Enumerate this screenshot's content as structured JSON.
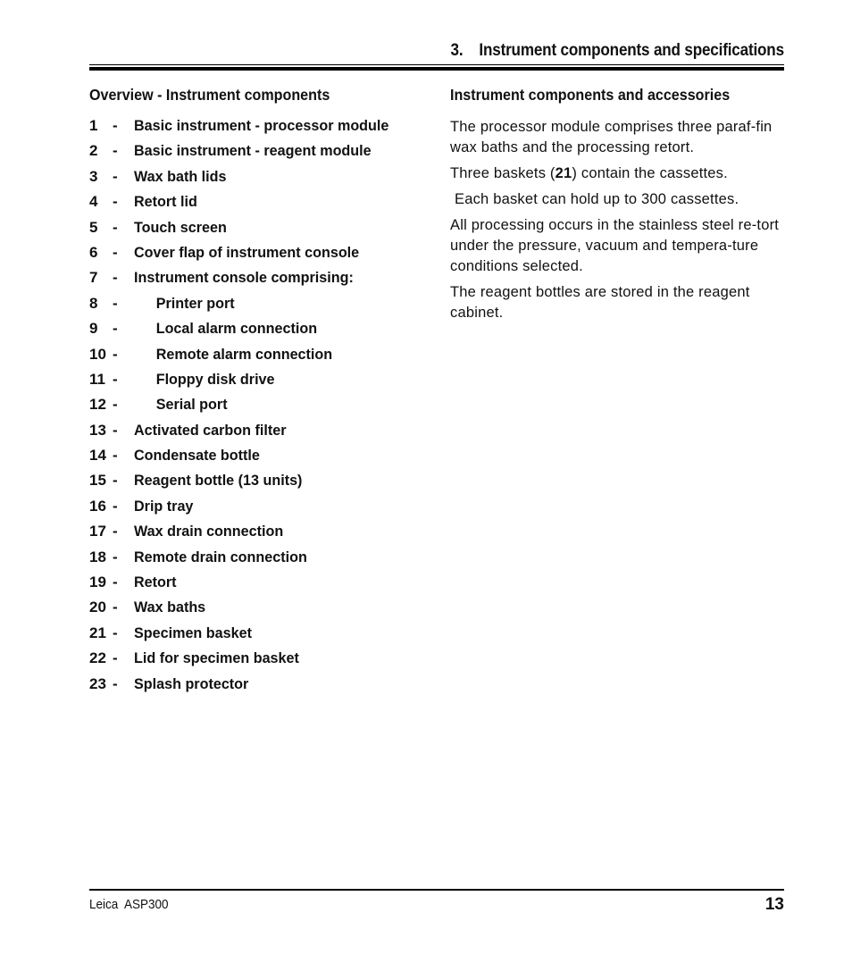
{
  "header": {
    "chapter_number": "3.",
    "chapter_title": "Instrument components and specifications"
  },
  "left": {
    "heading": "Overview - Instrument components",
    "items": [
      {
        "num": "1",
        "text": "Basic instrument - processor module",
        "sub": false
      },
      {
        "num": "2",
        "text": "Basic instrument - reagent module",
        "sub": false
      },
      {
        "num": "3",
        "text": "Wax bath lids",
        "sub": false
      },
      {
        "num": "4",
        "text": "Retort lid",
        "sub": false
      },
      {
        "num": "5",
        "text": "Touch screen",
        "sub": false
      },
      {
        "num": "6",
        "text": "Cover flap of instrument console",
        "sub": false
      },
      {
        "num": "7",
        "text": "Instrument console comprising:",
        "sub": false
      },
      {
        "num": "8",
        "text": "Printer port",
        "sub": true
      },
      {
        "num": "9",
        "text": "Local alarm connection",
        "sub": true
      },
      {
        "num": "10",
        "text": "Remote alarm connection",
        "sub": true
      },
      {
        "num": "11",
        "text": "Floppy disk drive",
        "sub": true
      },
      {
        "num": "12",
        "text": "Serial port",
        "sub": true
      },
      {
        "num": "13",
        "text": "Activated carbon filter",
        "sub": false
      },
      {
        "num": "14",
        "text": "Condensate bottle",
        "sub": false
      },
      {
        "num": "15",
        "text": "Reagent bottle (13 units)",
        "sub": false
      },
      {
        "num": "16",
        "text": "Drip tray",
        "sub": false
      },
      {
        "num": "17",
        "text": "Wax drain connection",
        "sub": false
      },
      {
        "num": "18",
        "text": "Remote drain connection",
        "sub": false
      },
      {
        "num": "19",
        "text": "Retort",
        "sub": false
      },
      {
        "num": "20",
        "text": "Wax baths",
        "sub": false
      },
      {
        "num": "21",
        "text": "Specimen basket",
        "sub": false
      },
      {
        "num": "22",
        "text": "Lid for specimen basket",
        "sub": false
      },
      {
        "num": "23",
        "text": "Splash protector",
        "sub": false
      }
    ],
    "dash": "-"
  },
  "right": {
    "heading": "Instrument components and accessories",
    "p1": "The processor module comprises three paraf-fin wax baths and the processing retort.",
    "p2_before": "Three baskets (",
    "p2_bold": "21",
    "p2_after": ") contain the cassettes.",
    "p3": "Each basket can hold up to 300 cassettes.",
    "p4": "All processing occurs in the stainless steel re-tort under the pressure, vacuum and tempera-ture conditions selected.",
    "p5": "The reagent bottles are stored in the reagent cabinet."
  },
  "footer": {
    "left": "Leica  ASP300",
    "page": "13"
  }
}
